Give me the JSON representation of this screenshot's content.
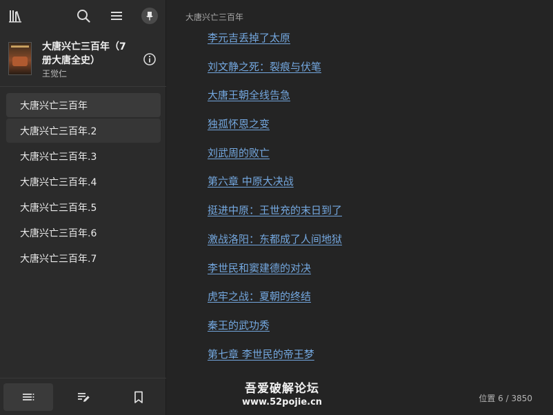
{
  "sidebar": {
    "book_title": "大唐兴亡三百年（7册大唐全史）",
    "book_author": "王觉仁",
    "toc": [
      {
        "label": "大唐兴亡三百年"
      },
      {
        "label": "大唐兴亡三百年.2"
      },
      {
        "label": "大唐兴亡三百年.3"
      },
      {
        "label": "大唐兴亡三百年.4"
      },
      {
        "label": "大唐兴亡三百年.5"
      },
      {
        "label": "大唐兴亡三百年.6"
      },
      {
        "label": "大唐兴亡三百年.7"
      }
    ]
  },
  "main": {
    "running_title": "大唐兴亡三百年",
    "chapters": [
      "李元吉丢掉了太原",
      "刘文静之死：裂痕与伏笔",
      "大唐王朝全线告急",
      "独孤怀恩之变",
      "刘武周的败亡",
      "第六章 中原大决战",
      "挺进中原：王世充的末日到了",
      "激战洛阳：东都成了人间地狱",
      "李世民和窦建德的对决",
      "虎牢之战：夏朝的终结",
      "秦王的武功秀",
      "第七章 李世民的帝王梦"
    ],
    "position_text": "位置 6 / 3850"
  },
  "watermark": {
    "line1": "吾爱破解论坛",
    "line2": "www.52pojie.cn"
  },
  "colors": {
    "link": "#74a8e0",
    "sidebar_bg": "#2b2b2b",
    "main_bg": "#242424"
  },
  "icons": {
    "library": "library-icon",
    "search": "search-icon",
    "menu": "menu-icon",
    "pin": "pin-icon",
    "info": "info-icon",
    "contents": "contents-icon",
    "annotations": "annotations-icon",
    "bookmark": "bookmark-icon"
  }
}
